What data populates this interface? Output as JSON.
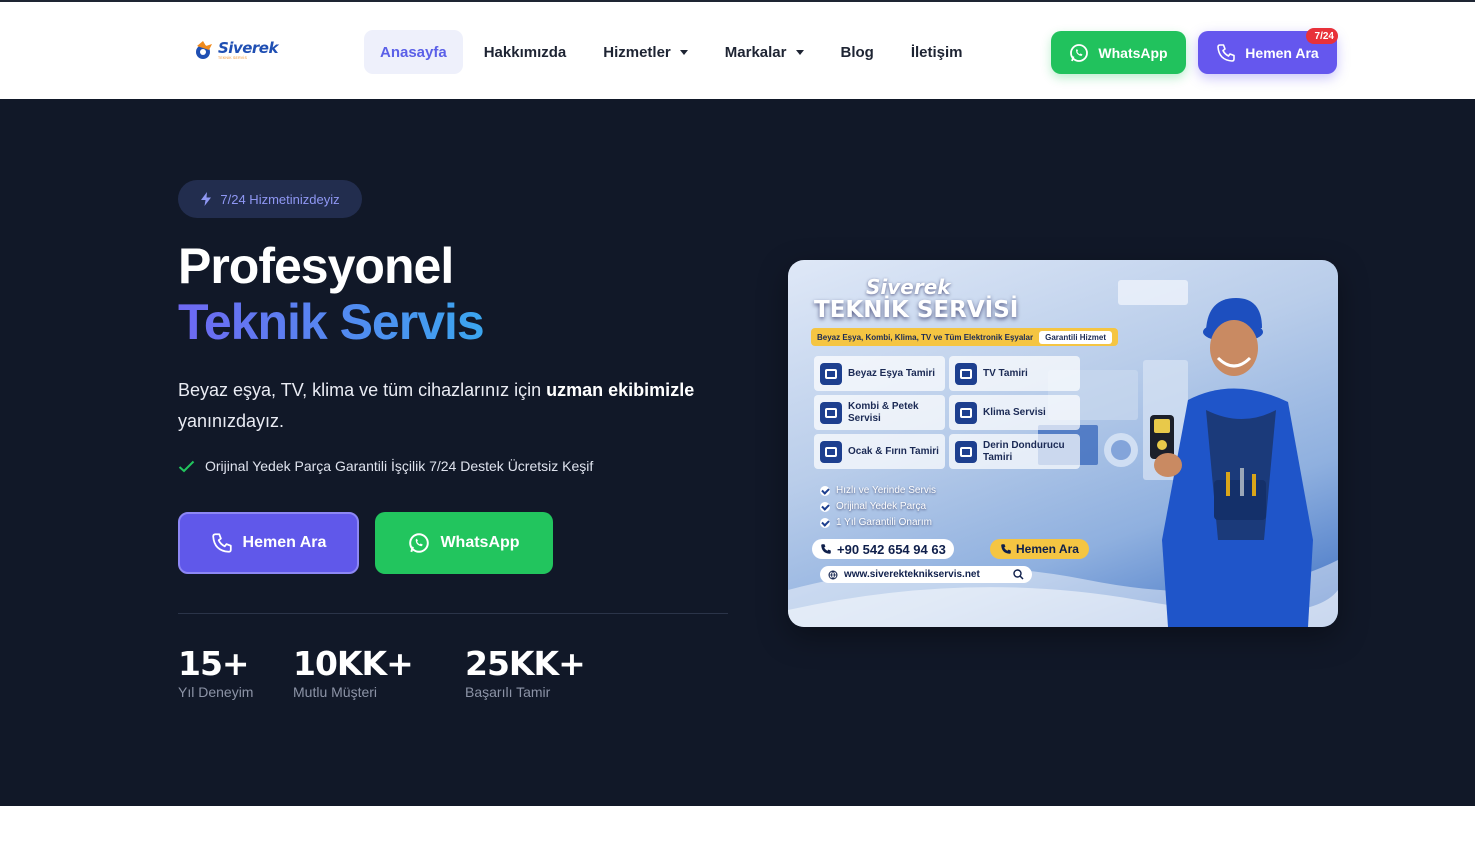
{
  "header": {
    "logo": {
      "brand": "Siverek",
      "tagline": "TEKNİK SERVİS"
    },
    "nav": [
      {
        "label": "Anasayfa",
        "active": true,
        "dropdown": false
      },
      {
        "label": "Hakkımızda",
        "active": false,
        "dropdown": false
      },
      {
        "label": "Hizmetler",
        "active": false,
        "dropdown": true
      },
      {
        "label": "Markalar",
        "active": false,
        "dropdown": true
      },
      {
        "label": "Blog",
        "active": false,
        "dropdown": false
      },
      {
        "label": "İletişim",
        "active": false,
        "dropdown": false
      }
    ],
    "whatsapp_label": "WhatsApp",
    "call_label": "Hemen Ara",
    "badge": "7/24"
  },
  "hero": {
    "pill": "7/24 Hizmetinizdeyiz",
    "title_line1": "Profesyonel",
    "title_line2": "Teknik Servis",
    "lead_before": "Beyaz eşya, TV, klima ve tüm cihazlarınız için ",
    "lead_bold": "uzman ekibimizle",
    "lead_after": " yanınızdayız.",
    "features": "Orijinal Yedek Parça Garantili İşçilik 7/24 Destek Ücretsiz Keşif",
    "call_label": "Hemen Ara",
    "whatsapp_label": "WhatsApp",
    "stats": [
      {
        "value": "15+",
        "label": "Yıl Deneyim"
      },
      {
        "value": "10KK+",
        "label": "Mutlu Müşteri"
      },
      {
        "value": "25KK+",
        "label": "Başarılı Tamir"
      }
    ]
  },
  "banner": {
    "title1": "Siverek",
    "title2": "TEKNİK SERVİSİ",
    "strip": "Beyaz Eşya, Kombi, Klima, TV ve Tüm Elektronik Eşyalar",
    "strip_badge": "Garantili Hizmet",
    "services": [
      "Beyaz Eşya Tamiri",
      "TV Tamiri",
      "Kombi & Petek Servisi",
      "Klima Servisi",
      "Ocak & Fırın Tamiri",
      "Derin Dondurucu Tamiri"
    ],
    "checks": [
      "Hızlı ve Yerinde Servis",
      "Orijinal Yedek Parça",
      "1 Yıl Garantili Onarım"
    ],
    "phone": "+90 542 654 94 63",
    "call_label": "Hemen Ara",
    "website": "www.siverekteknikservis.net"
  },
  "colors": {
    "hero_bg": "#111828",
    "accent": "#6058ea",
    "whatsapp": "#22c55e",
    "gradient_start": "#6f68f2",
    "gradient_end": "#3ba6ef"
  },
  "icons": [
    "phone-icon",
    "whatsapp-icon",
    "bolt-icon",
    "check-icon",
    "search-icon",
    "globe-icon"
  ]
}
